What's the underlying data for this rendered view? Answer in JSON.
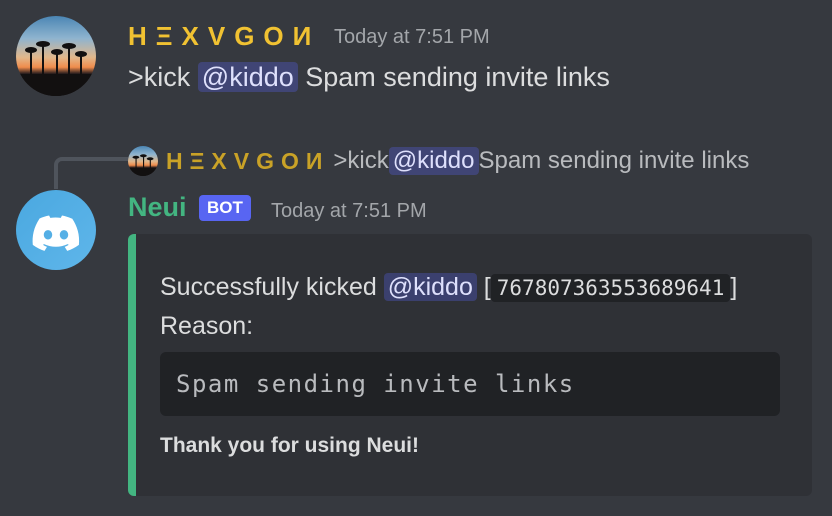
{
  "message1": {
    "username": "HΞXVGOИ",
    "timestamp": "Today at 7:51 PM",
    "content_prefix": ">kick ",
    "mention": "@kiddo",
    "content_suffix": " Spam sending invite links"
  },
  "reply_preview": {
    "username": "HΞXVGOИ",
    "content_prefix": ">kick ",
    "mention": "@kiddo",
    "content_suffix": " Spam sending invite links"
  },
  "message2": {
    "username": "Neui",
    "badge": "BOT",
    "timestamp": "Today at 7:51 PM",
    "embed": {
      "line1_prefix": "Successfully kicked ",
      "mention": "@kiddo",
      "bracket_open": " [",
      "user_id": "767807363553689641",
      "bracket_close": "]",
      "reason_label": "Reason:",
      "reason_code": "Spam sending invite links",
      "footer": "Thank you for using Neui!",
      "accent_color": "#43b581"
    }
  },
  "colors": {
    "background": "#36393f",
    "embed_background": "#2f3136",
    "username_gold": "#f1c232",
    "bot_name_green": "#43b581",
    "bot_badge": "#5865f2"
  },
  "icons": {
    "user_avatar": "sunset-palm-avatar-icon",
    "bot_avatar": "discord-logo-icon"
  }
}
